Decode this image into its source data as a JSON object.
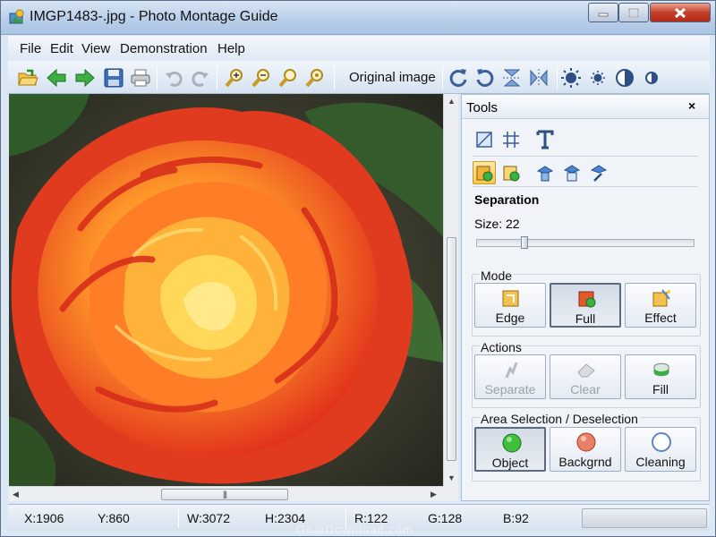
{
  "window": {
    "title": "IMGP1483-.jpg - Photo Montage Guide"
  },
  "menu": {
    "items": [
      "File",
      "Edit",
      "View",
      "Demonstration",
      "Help"
    ]
  },
  "toolbar": {
    "buttons": [
      "open-icon",
      "back-arrow-icon",
      "forward-arrow-icon",
      "save-icon",
      "print-icon",
      "undo-icon",
      "redo-icon",
      "zoom-in-icon",
      "zoom-out-icon",
      "zoom-fit-icon",
      "zoom-actual-icon",
      "rotate-right-icon",
      "rotate-left-icon",
      "flip-vertical-icon",
      "flip-horizontal-icon",
      "brightness-up-icon",
      "brightness-down-icon",
      "contrast-up-icon",
      "contrast-down-icon"
    ],
    "original_image_label": "Original image"
  },
  "tools_panel": {
    "title": "Tools",
    "close_glyph": "×",
    "section_title": "Separation",
    "size_label": "Size: 22",
    "size_value": 22,
    "mode": {
      "title": "Mode",
      "buttons": [
        {
          "label": "Edge",
          "icon": "edge-mode-icon",
          "pressed": false
        },
        {
          "label": "Full",
          "icon": "full-mode-icon",
          "pressed": true
        },
        {
          "label": "Effect",
          "icon": "effect-mode-icon",
          "pressed": false
        }
      ]
    },
    "actions": {
      "title": "Actions",
      "buttons": [
        {
          "label": "Separate",
          "icon": "separate-icon",
          "enabled": false
        },
        {
          "label": "Clear",
          "icon": "eraser-icon",
          "enabled": false
        },
        {
          "label": "Fill",
          "icon": "fill-icon",
          "enabled": true
        }
      ]
    },
    "area": {
      "title": "Area Selection / Deselection",
      "buttons": [
        {
          "label": "Object",
          "icon": "object-green-circle-icon",
          "pressed": true
        },
        {
          "label": "Backgrnd",
          "icon": "background-red-circle-icon",
          "pressed": false
        },
        {
          "label": "Cleaning",
          "icon": "cleaning-circle-icon",
          "pressed": false
        }
      ]
    }
  },
  "statusbar": {
    "x": "X:1906",
    "y": "Y:860",
    "w": "W:3072",
    "h": "H:2304",
    "r": "R:122",
    "g": "G:128",
    "b": "B:92"
  },
  "watermark": "GearDownload.com",
  "colors": {
    "accent": "#f7c74c",
    "titlebar": "#b9cfe9",
    "close": "#c4402a"
  }
}
